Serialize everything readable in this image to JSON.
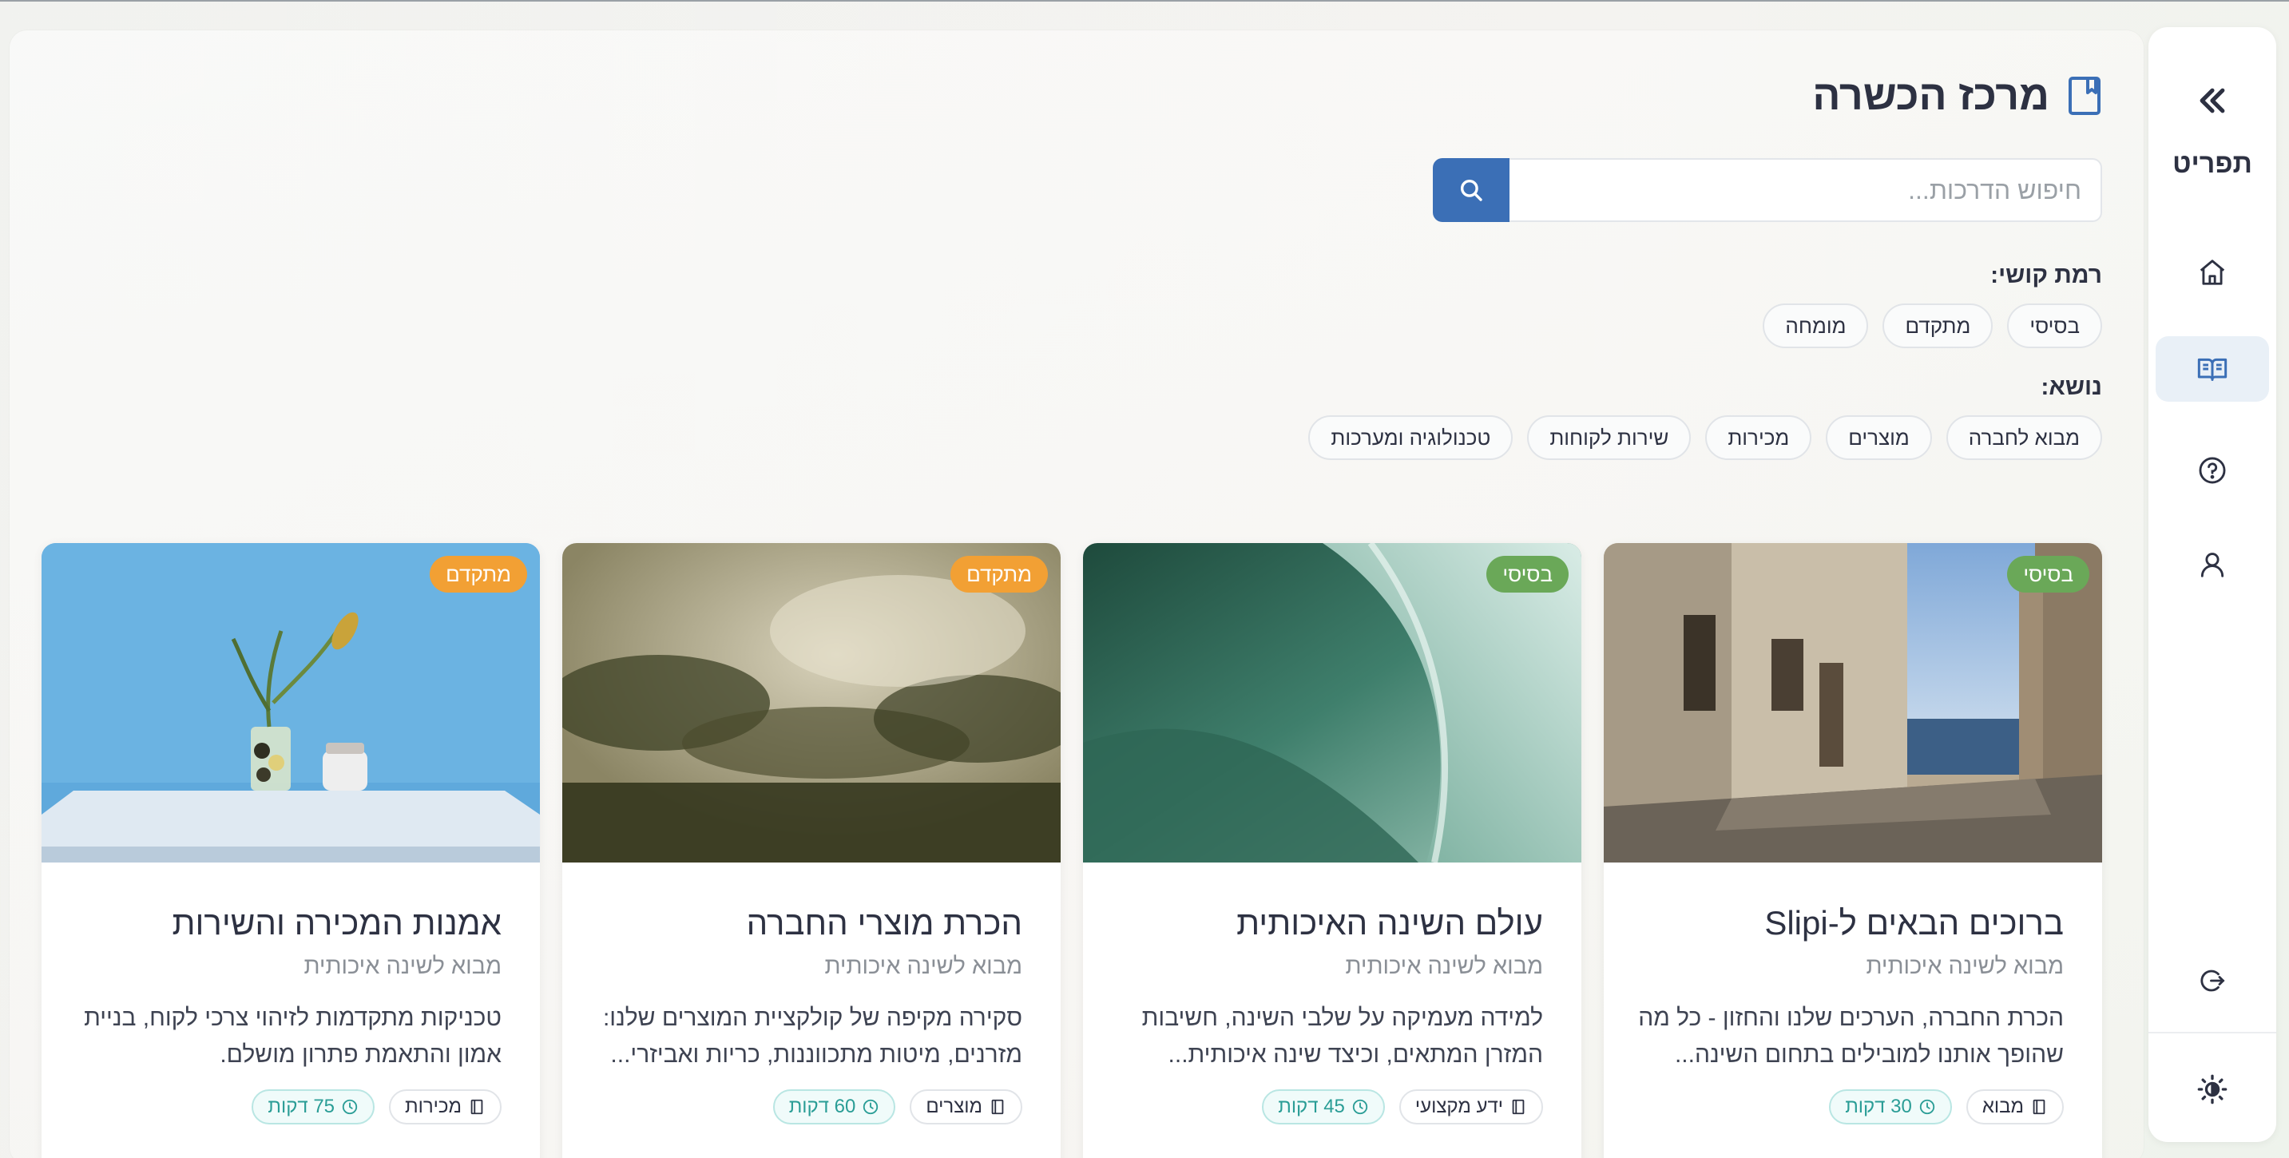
{
  "sidebar": {
    "title": "תפריט",
    "items": [
      {
        "id": "home",
        "icon": "home-icon"
      },
      {
        "id": "training",
        "icon": "open-book-icon",
        "active": true
      },
      {
        "id": "help",
        "icon": "help-circle-icon"
      },
      {
        "id": "profile",
        "icon": "user-icon"
      }
    ],
    "logout_icon": "logout-icon",
    "theme_icon": "theme-toggle-icon",
    "collapse_icon": "double-chevron-icon"
  },
  "header": {
    "title": "מרכז הכשרה",
    "icon": "bookmark-icon"
  },
  "search": {
    "placeholder": "חיפוש הדרכות...",
    "value": "",
    "button_icon": "search-icon"
  },
  "filters": {
    "difficulty": {
      "label": "רמת קושי:",
      "options": [
        "בסיסי",
        "מתקדם",
        "מומחה"
      ]
    },
    "topic": {
      "label": "נושא:",
      "options": [
        "מבוא לחברה",
        "מוצרים",
        "מכירות",
        "שירות לקוחות",
        "טכנולוגיה ומערכות"
      ]
    }
  },
  "colors": {
    "accent": "#3b6fb6",
    "basic_badge": "#6aa858",
    "advanced_badge": "#f2a034",
    "time_tag": "#2a9d96"
  },
  "cards": [
    {
      "level": "בסיסי",
      "level_type": "basic",
      "title": "ברוכים הבאים ל-Slipi",
      "subtitle": "מבוא לשינה איכותית",
      "description": "הכרת החברה, הערכים שלנו והחזון - כל מה שהופך אותנו למובילים בתחום השינה...",
      "topic": "מבוא",
      "duration": "30 דקות",
      "image": "alley-by-sea"
    },
    {
      "level": "בסיסי",
      "level_type": "basic",
      "title": "עולם השינה האיכותית",
      "subtitle": "מבוא לשינה איכותית",
      "description": "למידה מעמיקה על שלבי השינה, חשיבות המזרן המתאים, וכיצד שינה איכותית...",
      "topic": "ידע מקצועי",
      "duration": "45 דקות",
      "image": "ocean-wave"
    },
    {
      "level": "מתקדם",
      "level_type": "advanced",
      "title": "הכרת מוצרי החברה",
      "subtitle": "מבוא לשינה איכותית",
      "description": "סקירה מקיפה של קולקציית המוצרים שלנו: מזרנים, מיטות מתכווננות, כריות ואביזרי...",
      "topic": "מוצרים",
      "duration": "60 דקות",
      "image": "misty-forest"
    },
    {
      "level": "מתקדם",
      "level_type": "advanced",
      "title": "אמנות המכירה והשירות",
      "subtitle": "מבוא לשינה איכותית",
      "description": "טכניקות מתקדמות לזיהוי צרכי לקוח, בניית אמון והתאמת פתרון מושלם.",
      "topic": "מכירות",
      "duration": "75 דקות",
      "image": "plant-on-table"
    }
  ]
}
